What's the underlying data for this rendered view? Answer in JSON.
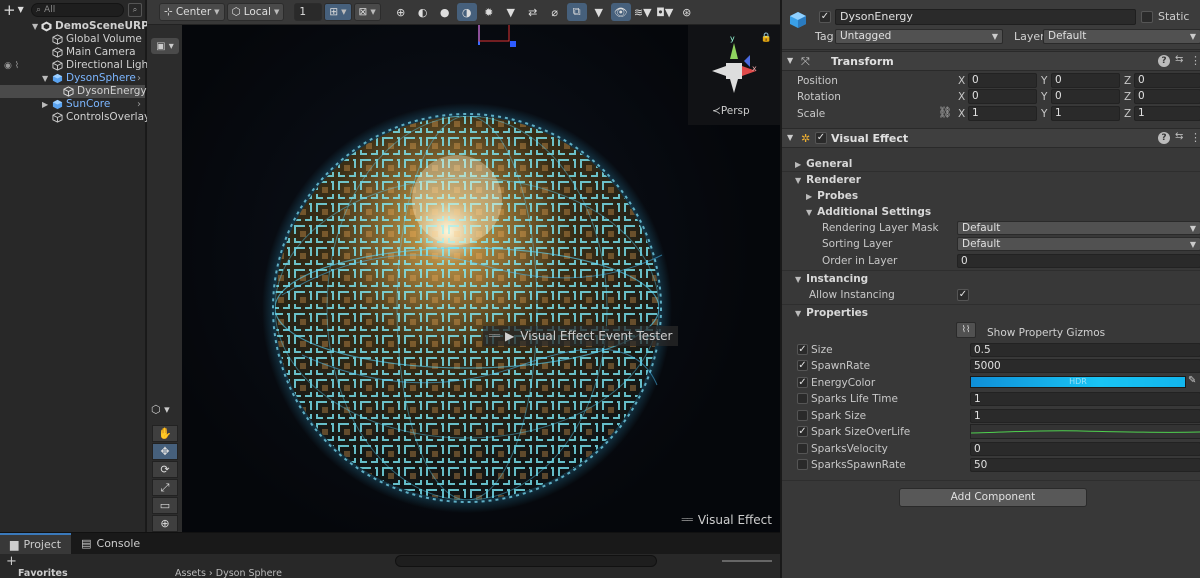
{
  "hierarchy": {
    "add_label": "+",
    "search_placeholder": "All",
    "items": [
      {
        "label": "DemoSceneURP",
        "depth": 0,
        "expanded": true,
        "prefab": false,
        "selected": false
      },
      {
        "label": "Global Volume",
        "depth": 1,
        "prefab": false,
        "selected": false
      },
      {
        "label": "Main Camera",
        "depth": 1,
        "prefab": false,
        "selected": false
      },
      {
        "label": "Directional Light",
        "depth": 1,
        "prefab": false,
        "selected": false
      },
      {
        "label": "DysonSphere",
        "depth": 1,
        "expanded": true,
        "prefab": true,
        "selected": false
      },
      {
        "label": "DysonEnergy",
        "depth": 2,
        "prefab": false,
        "selected": true
      },
      {
        "label": "SunCore",
        "depth": 1,
        "expanded": false,
        "prefab": true,
        "selected": false
      },
      {
        "label": "ControlsOverlay",
        "depth": 1,
        "prefab": false,
        "selected": false
      }
    ]
  },
  "scene_toolbar": {
    "pivot": "Center",
    "space": "Local",
    "snap_increment": "1"
  },
  "scene": {
    "persp_label": "Persp",
    "event_tester_label": "Visual Effect Event Tester",
    "overlay_label": "Visual Effect",
    "colors": {
      "sphere_glow": "#6fe6ff",
      "sphere_core": "#2b2410"
    }
  },
  "bottom": {
    "tabs": [
      {
        "label": "Project",
        "active": true
      },
      {
        "label": "Console",
        "active": false
      }
    ],
    "favorites_label": "Favorites",
    "breadcrumb": "Assets › Dyson Sphere"
  },
  "inspector": {
    "object_name": "DysonEnergy",
    "active": true,
    "static_label": "Static",
    "tag_label": "Tag",
    "tag_value": "Untagged",
    "layer_label": "Layer",
    "layer_value": "Default",
    "transform": {
      "title": "Transform",
      "position_label": "Position",
      "rotation_label": "Rotation",
      "scale_label": "Scale",
      "position": {
        "x": "0",
        "y": "0",
        "z": "0"
      },
      "rotation": {
        "x": "0",
        "y": "0",
        "z": "0"
      },
      "scale": {
        "x": "1",
        "y": "1",
        "z": "1"
      },
      "axis_x": "X",
      "axis_y": "Y",
      "axis_z": "Z"
    },
    "visual_effect": {
      "title": "Visual Effect",
      "general_label": "General",
      "renderer_label": "Renderer",
      "probes_label": "Probes",
      "additional_settings_label": "Additional Settings",
      "rendering_layer_mask_label": "Rendering Layer Mask",
      "rendering_layer_mask_value": "Default",
      "sorting_layer_label": "Sorting Layer",
      "sorting_layer_value": "Default",
      "order_in_layer_label": "Order in Layer",
      "order_in_layer_value": "0",
      "instancing_label": "Instancing",
      "allow_instancing_label": "Allow Instancing",
      "properties_label": "Properties",
      "show_gizmos_label": "Show Property Gizmos",
      "properties": [
        {
          "label": "Size",
          "checked": true,
          "value": "0.5",
          "kind": "text"
        },
        {
          "label": "SpawnRate",
          "checked": true,
          "value": "5000",
          "kind": "text"
        },
        {
          "label": "EnergyColor",
          "checked": true,
          "value": "HDR",
          "kind": "color"
        },
        {
          "label": "Sparks Life Time",
          "checked": false,
          "value": "1",
          "kind": "text"
        },
        {
          "label": "Spark Size",
          "checked": false,
          "value": "1",
          "kind": "text"
        },
        {
          "label": "Spark SizeOverLife",
          "checked": true,
          "value": "",
          "kind": "curve"
        },
        {
          "label": "SparksVelocity",
          "checked": false,
          "value": "0",
          "kind": "text"
        },
        {
          "label": "SparksSpawnRate",
          "checked": false,
          "value": "50",
          "kind": "text"
        }
      ]
    },
    "add_component_label": "Add Component"
  }
}
